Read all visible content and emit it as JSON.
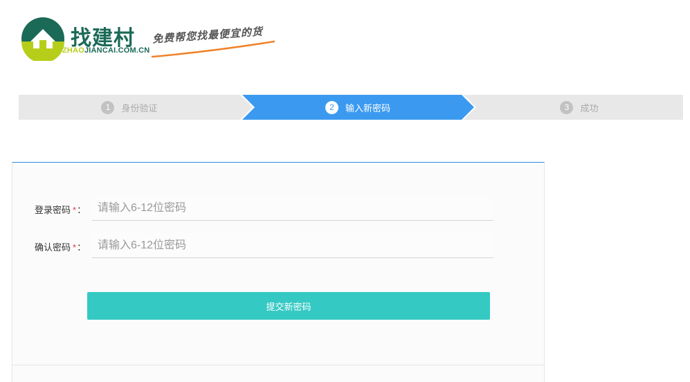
{
  "header": {
    "logo_title": "找建村",
    "logo_domain_part1": "ZHAO",
    "logo_domain_part2": "JIANCAI.COM.CN",
    "slogan": "免费帮您找最便宜的货",
    "colors": {
      "brand_green": "#1b6a57",
      "brand_lime": "#b6ce1a",
      "slogan_line": "#f0822a"
    }
  },
  "steps": [
    {
      "num": "1",
      "label": "身份验证",
      "state": "inactive"
    },
    {
      "num": "2",
      "label": "输入新密码",
      "state": "active"
    },
    {
      "num": "3",
      "label": "成功",
      "state": "inactive"
    }
  ],
  "form": {
    "password": {
      "label": "登录密码",
      "required_mark": "*",
      "colon": "：",
      "value": "",
      "placeholder": "请输入6-12位密码"
    },
    "confirm": {
      "label": "确认密码",
      "required_mark": "*",
      "colon": "：",
      "value": "",
      "placeholder": "请输入6-12位密码"
    },
    "submit_label": "提交新密码"
  },
  "colors": {
    "active_step": "#3b9af0",
    "inactive_step": "#e8e8e8",
    "submit": "#35c9c4",
    "panel_top_border": "#2f8ad8",
    "required": "#e4393c"
  }
}
